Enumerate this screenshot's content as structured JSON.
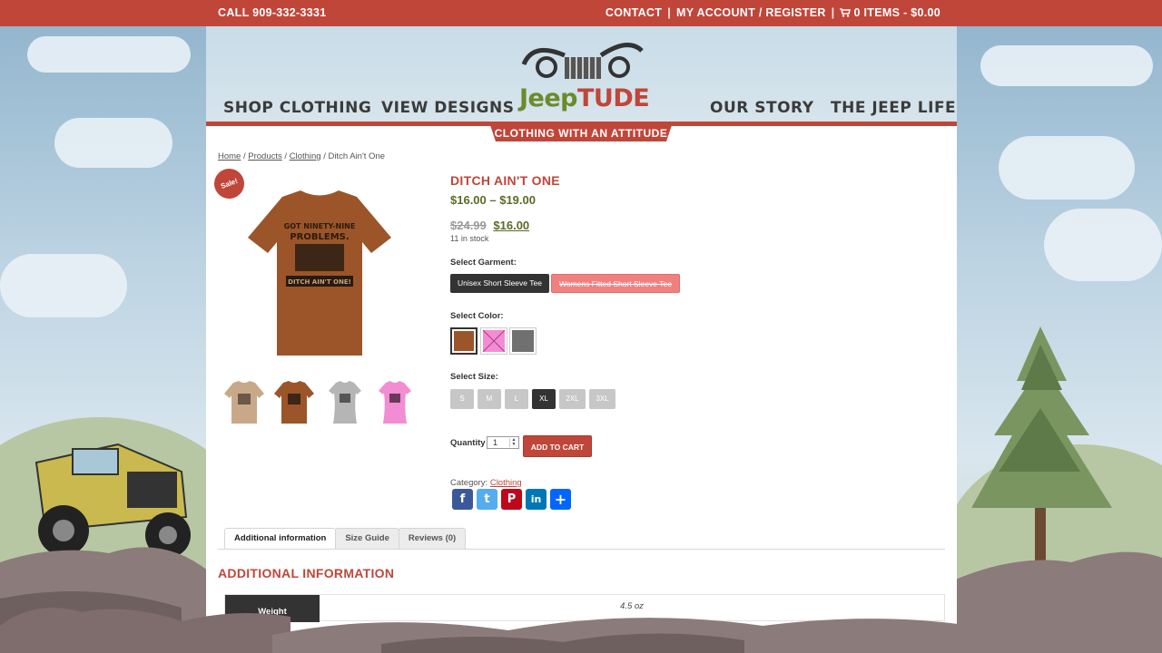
{
  "topbar": {
    "phone": "CALL 909-332-3331",
    "contact": "CONTACT",
    "account": "MY ACCOUNT / REGISTER",
    "cart": "0 ITEMS - $0.00",
    "sep": "|"
  },
  "nav": {
    "shop": "SHOP CLOTHING",
    "designs": "VIEW DESIGNS",
    "story": "OUR STORY",
    "life": "THE JEEP LIFE"
  },
  "logo": {
    "jeep": "Jeep",
    "tude": "TUDE"
  },
  "tagline": "CLOTHING WITH AN ATTITUDE",
  "breadcrumb": {
    "home": "Home",
    "products": "Products",
    "clothing": "Clothing",
    "current": "Ditch Ain't One",
    "sep": "/"
  },
  "sale_badge": "Sale!",
  "tshirt_text": {
    "line1": "GOT NINETY-NINE",
    "line2": "PROBLEMS.",
    "line3": "DITCH AIN'T ONE!"
  },
  "product": {
    "title": "DITCH AIN'T ONE",
    "price_range": "$16.00 – $19.00",
    "old_price": "$24.99",
    "new_price": "$16.00",
    "stock": "11 in stock"
  },
  "options": {
    "garment_label": "Select Garment:",
    "garments": [
      "Unisex Short Sleeve Tee",
      "Womens Fitted Short Sleeve Tee"
    ],
    "color_label": "Select Color:",
    "colors": [
      "#9b5528",
      "#f28cd3",
      "#707070"
    ],
    "size_label": "Select Size:",
    "sizes": [
      "S",
      "M",
      "L",
      "XL",
      "2XL",
      "3XL"
    ],
    "selected_size": "XL"
  },
  "cart": {
    "qty_label": "Quantity",
    "qty_value": "1",
    "add_label": "ADD TO CART"
  },
  "category": {
    "label": "Category:",
    "value": "Clothing"
  },
  "share": {
    "facebook": "f",
    "twitter": "t",
    "pinterest": "P",
    "linkedin": "in",
    "more": "+"
  },
  "tabs": [
    "Additional information",
    "Size Guide",
    "Reviews (0)"
  ],
  "additional": {
    "title": "ADDITIONAL INFORMATION",
    "weight_label": "Weight",
    "weight_value": "4.5 oz"
  },
  "colors": {
    "brand_red": "#c0463a",
    "price_green": "#5b6b25",
    "dark": "#333333"
  }
}
